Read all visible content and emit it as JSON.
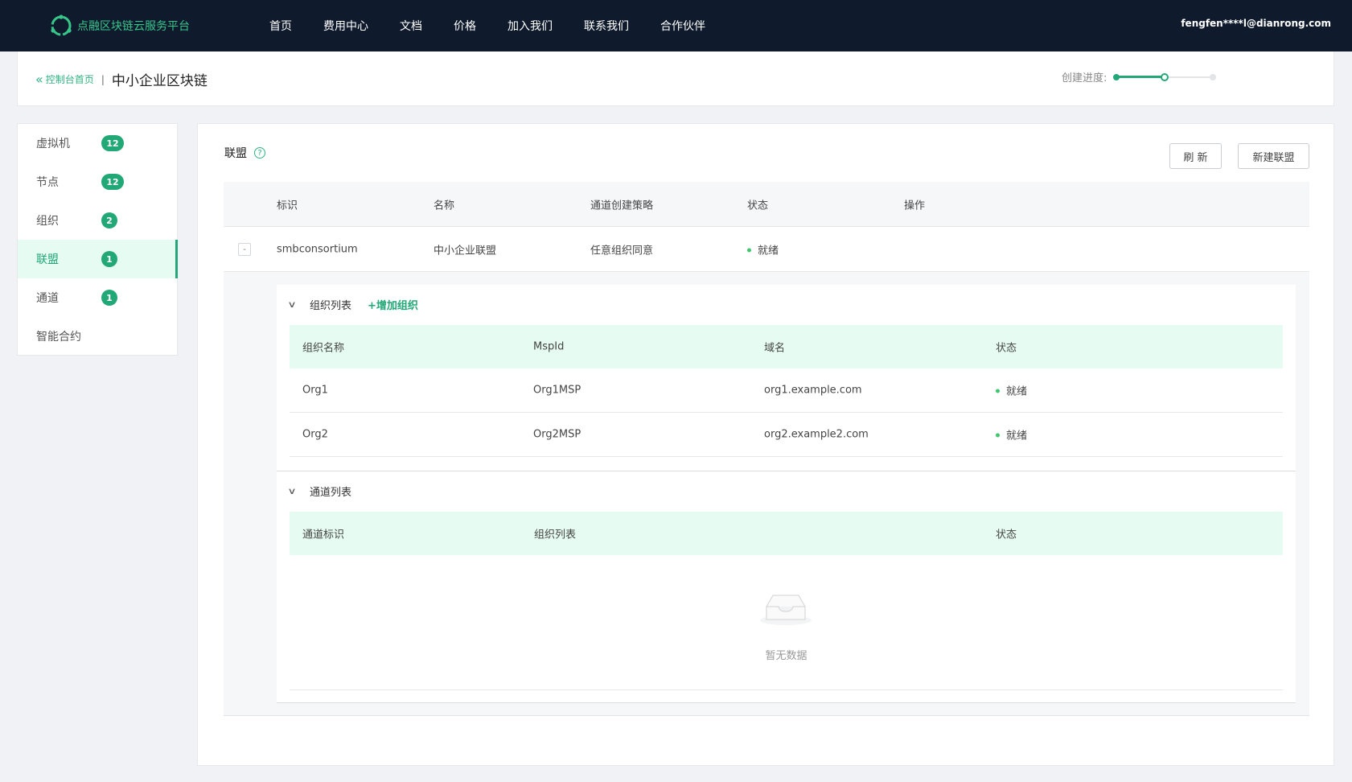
{
  "brand": {
    "name": "点融区块链云服务平台",
    "color": "#37c58a"
  },
  "nav": {
    "items": [
      "首页",
      "费用中心",
      "文档",
      "价格",
      "加入我们",
      "联系我们",
      "合作伙伴"
    ]
  },
  "user": {
    "email": "fengfen****l@dianrong.com"
  },
  "breadcrumb": {
    "home": "控制台首页",
    "separator": "|",
    "title": "中小企业区块链"
  },
  "progress": {
    "label": "创建进度:",
    "value": 0.5
  },
  "sidebar": {
    "items": [
      {
        "label": "虚拟机",
        "count": "12"
      },
      {
        "label": "节点",
        "count": "12"
      },
      {
        "label": "组织",
        "count": "2"
      },
      {
        "label": "联盟",
        "count": "1"
      },
      {
        "label": "通道",
        "count": "1"
      },
      {
        "label": "智能合约",
        "count": ""
      }
    ],
    "active_index": 3
  },
  "main": {
    "section_title": "联盟",
    "refresh_label": "刷 新",
    "new_label": "新建联盟",
    "table": {
      "headers": [
        "标识",
        "名称",
        "通道创建策略",
        "状态",
        "操作"
      ],
      "rows": [
        {
          "expander": "-",
          "id": "smbconsortium",
          "name": "中小企业联盟",
          "policy": "任意组织同意",
          "status": "就绪"
        }
      ]
    },
    "org_list": {
      "title": "组织列表",
      "add_label": "+增加组织",
      "headers": [
        "组织名称",
        "MspId",
        "域名",
        "状态"
      ],
      "rows": [
        {
          "name": "Org1",
          "msp": "Org1MSP",
          "domain": "org1.example.com",
          "status": "就绪"
        },
        {
          "name": "Org2",
          "msp": "Org2MSP",
          "domain": "org2.example2.com",
          "status": "就绪"
        }
      ]
    },
    "channel_list": {
      "title": "通道列表",
      "headers": [
        "通道标识",
        "组织列表",
        "状态"
      ],
      "empty_text": "暂无数据"
    }
  },
  "colors": {
    "accent": "#22a877",
    "nav_bg": "#0f1b2d",
    "status_ok": "#3fc66e"
  }
}
